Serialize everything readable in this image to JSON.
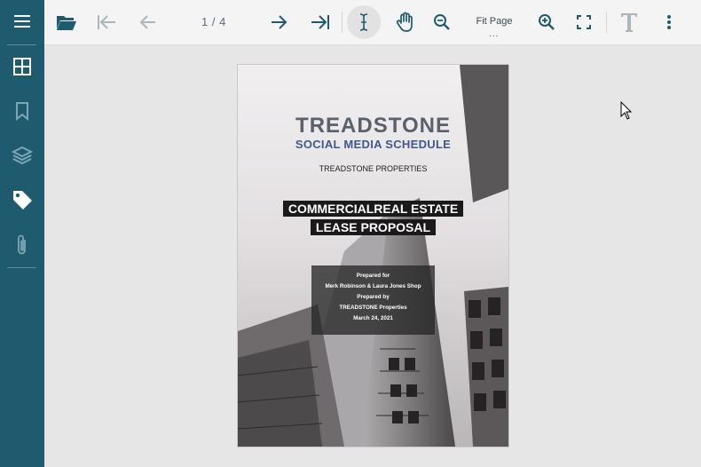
{
  "toolbar": {
    "page_counter": "1 / 4",
    "fit_label": "Fit Page",
    "fit_dots": "...",
    "icons": [
      "folder-open-icon",
      "first-page-icon",
      "previous-page-icon",
      "next-page-icon",
      "last-page-icon",
      "text-select-icon",
      "pan-hand-icon",
      "zoom-out-icon",
      "zoom-in-icon",
      "fullscreen-icon",
      "text-tool-icon",
      "more-options-icon"
    ]
  },
  "sidebar": {
    "icons": [
      "menu-icon",
      "thumbnails-icon",
      "bookmarks-icon",
      "layers-icon",
      "tags-icon",
      "attachments-icon"
    ]
  },
  "document": {
    "brand": "TREADSTONE",
    "subtitle": "SOCIAL MEDIA SCHEDULE",
    "company": "TREADSTONE PROPERTIES",
    "title_line1": "COMMERCIALREAL ESTATE",
    "title_line2": "LEASE PROPOSAL",
    "prepared_for_label": "Prepared for",
    "prepared_for": "Merk Robinson & Laura Jones Shop",
    "prepared_by_label": "Prepared by",
    "prepared_by": "TREADSTONE Properties",
    "date": "March 24, 2021"
  },
  "colors": {
    "sidebar": "#1e5b6e",
    "toolbar": "#f4f4f4",
    "toolbar_icon": "#1e5b6e",
    "brand_blue": "#3e5a8c"
  }
}
